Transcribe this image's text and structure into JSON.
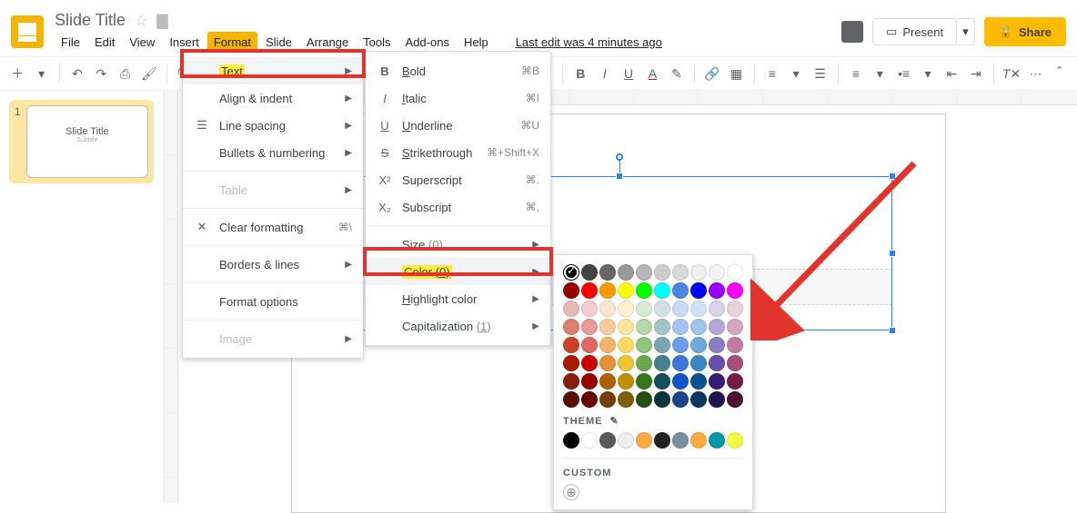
{
  "doc": {
    "title": "Slide Title"
  },
  "menubar": {
    "file": "File",
    "edit": "Edit",
    "view": "View",
    "insert": "Insert",
    "format": "Format",
    "slide": "Slide",
    "arrange": "Arrange",
    "tools": "Tools",
    "addons": "Add-ons",
    "help": "Help",
    "last_edit": "Last edit was 4 minutes ago"
  },
  "header": {
    "present": "Present",
    "share": "Share"
  },
  "format_menu": {
    "text": "Text",
    "align": "Align & indent",
    "line_spacing": "Line spacing",
    "bullets": "Bullets & numbering",
    "table": "Table",
    "clear_fmt": "Clear formatting",
    "clear_fmt_sc": "⌘\\",
    "borders": "Borders & lines",
    "format_options": "Format options",
    "image": "Image"
  },
  "text_menu": {
    "bold": "Bold",
    "bold_sc": "⌘B",
    "italic": "Italic",
    "italic_sc": "⌘I",
    "underline": "Underline",
    "underline_sc": "⌘U",
    "strike": "Strikethrough",
    "strike_sc": "⌘+Shift+X",
    "super": "Superscript",
    "super_sc": "⌘.",
    "sub": "Subscript",
    "sub_sc": "⌘,",
    "size": "Size",
    "size_hint": "(0)",
    "color": "Color",
    "color_hint": "(0)",
    "highlight": "Highlight color",
    "caps": "Capitalization",
    "caps_hint": "(1)"
  },
  "picker": {
    "theme": "THEME",
    "custom": "CUSTOM",
    "rows": [
      [
        "#000000",
        "#434343",
        "#666666",
        "#999999",
        "#b7b7b7",
        "#cccccc",
        "#d9d9d9",
        "#efefef",
        "#f3f3f3",
        "#ffffff"
      ],
      [
        "#980000",
        "#ff0000",
        "#ff9900",
        "#ffff00",
        "#00ff00",
        "#00ffff",
        "#4a86e8",
        "#0000ff",
        "#9900ff",
        "#ff00ff"
      ],
      [
        "#e6b8af",
        "#f4cccc",
        "#fce5cd",
        "#fff2cc",
        "#d9ead3",
        "#d0e0e3",
        "#c9daf8",
        "#cfe2f3",
        "#d9d2e9",
        "#ead1dc"
      ],
      [
        "#dd7e6b",
        "#ea9999",
        "#f9cb9c",
        "#ffe599",
        "#b6d7a8",
        "#a2c4c9",
        "#a4c2f4",
        "#9fc5e8",
        "#b4a7d6",
        "#d5a6bd"
      ],
      [
        "#cc4125",
        "#e06666",
        "#f6b26b",
        "#ffd966",
        "#93c47d",
        "#76a5af",
        "#6d9eeb",
        "#6fa8dc",
        "#8e7cc3",
        "#c27ba0"
      ],
      [
        "#a61c00",
        "#cc0000",
        "#e69138",
        "#f1c232",
        "#6aa84f",
        "#45818e",
        "#3c78d8",
        "#3d85c6",
        "#674ea7",
        "#a64d79"
      ],
      [
        "#85200c",
        "#990000",
        "#b45f06",
        "#bf9000",
        "#38761d",
        "#134f5c",
        "#1155cc",
        "#0b5394",
        "#351c75",
        "#741b47"
      ],
      [
        "#5b0f00",
        "#660000",
        "#783f04",
        "#7f6000",
        "#274e13",
        "#0c343d",
        "#1c4587",
        "#073763",
        "#20124d",
        "#4c1130"
      ]
    ],
    "theme_row": [
      "#000000",
      "#ffffff",
      "#595959",
      "#eeeeee",
      "#ffab40",
      "#212121",
      "#78909c",
      "#ffab40",
      "#0097a7",
      "#eeff41"
    ]
  },
  "thumb": {
    "title": "Slide Title",
    "sub": "Subtitle"
  }
}
